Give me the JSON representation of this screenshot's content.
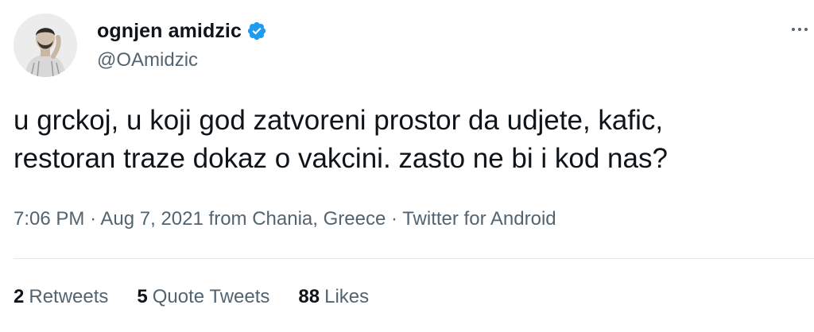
{
  "author": {
    "display_name": "ognjen amidzic",
    "handle": "@OAmidzic",
    "verified": true
  },
  "tweet": {
    "text": "u grckoj, u koji god zatvoreni prostor da udjete, kafic,\nrestoran traze dokaz o vakcini. zasto ne bi i kod nas?",
    "time": "7:06 PM",
    "date": "Aug 7, 2021",
    "location_prefix": "from",
    "location": "Chania, Greece",
    "source": "Twitter for Android",
    "separator": "·"
  },
  "stats": {
    "retweets_count": "2",
    "retweets_label": "Retweets",
    "quotes_count": "5",
    "quotes_label": "Quote Tweets",
    "likes_count": "88",
    "likes_label": "Likes"
  },
  "icons": {
    "verified": "verified-badge-icon",
    "more": "more-options-icon"
  },
  "colors": {
    "verified_blue": "#1d9bf0",
    "secondary_text": "#536471",
    "primary_text": "#0f1419"
  }
}
